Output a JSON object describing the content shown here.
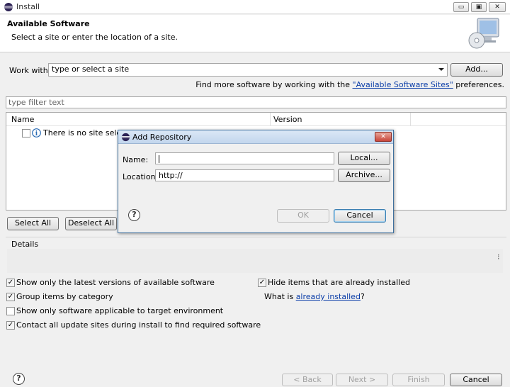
{
  "window": {
    "title": "Install",
    "minimize": "▭",
    "maximize": "▣",
    "close": "✕"
  },
  "header": {
    "title": "Available Software",
    "subtitle": "Select a site or enter the location of a site."
  },
  "work_with": {
    "label": "Work with:",
    "placeholder": "type or select a site",
    "add_button": "Add...",
    "find_more_prefix": "Find more software by working with the ",
    "find_more_link": "\"Available Software Sites\"",
    "find_more_suffix": " preferences."
  },
  "filter": {
    "placeholder": "type filter text"
  },
  "table": {
    "columns": [
      "Name",
      "Version"
    ],
    "empty_message": "There is no site selected."
  },
  "buttons": {
    "select_all": "Select All",
    "deselect_all": "Deselect All"
  },
  "details": {
    "label": "Details",
    "scroll_glyph": "⁝"
  },
  "options": {
    "latest_versions": {
      "label": "Show only the latest versions of available software",
      "checked": true
    },
    "group_by_category": {
      "label": "Group items by category",
      "checked": true
    },
    "target_env": {
      "label": "Show only software applicable to target environment",
      "checked": false
    },
    "contact_update_sites": {
      "label": "Contact all update sites during install to find required software",
      "checked": true
    },
    "hide_installed": {
      "label": "Hide items that are already installed",
      "checked": true
    },
    "what_is_prefix": "What is ",
    "what_is_link": "already installed",
    "what_is_suffix": "?"
  },
  "footer": {
    "back": "< Back",
    "next": "Next >",
    "finish": "Finish",
    "cancel": "Cancel",
    "help": "?"
  },
  "dialog": {
    "title": "Add Repository",
    "close": "✕",
    "name_label": "Name:",
    "name_value": "",
    "location_label": "Location:",
    "location_value": "http://",
    "local_button": "Local...",
    "archive_button": "Archive...",
    "ok_button": "OK",
    "cancel_button": "Cancel",
    "help": "?"
  },
  "check_glyph": "✓",
  "info_glyph": "i"
}
